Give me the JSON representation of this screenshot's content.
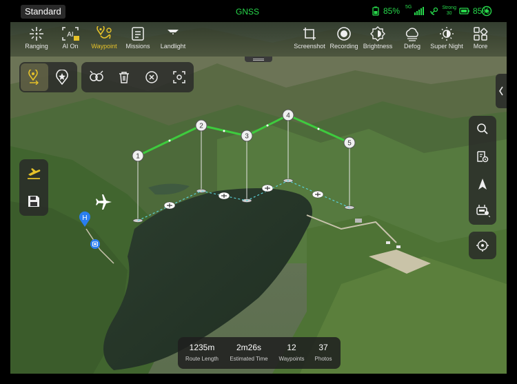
{
  "status": {
    "mode": "Standard",
    "gnss": "GNSS",
    "battery_1": "85%",
    "signal_label": "5G",
    "link_strength": "Strong",
    "link_value": "30",
    "battery_2": "85%"
  },
  "toolbar": {
    "left": [
      {
        "label": "Ranging",
        "icon": "crosshair-icon"
      },
      {
        "label": "AI On",
        "icon": "ai-icon"
      },
      {
        "label": "Waypoint",
        "icon": "waypoint-icon",
        "active": true
      },
      {
        "label": "Missions",
        "icon": "missions-icon"
      },
      {
        "label": "Landlight",
        "icon": "landlight-icon"
      }
    ],
    "right": [
      {
        "label": "Screenshot",
        "icon": "screenshot-icon"
      },
      {
        "label": "Recording",
        "icon": "record-icon"
      },
      {
        "label": "Brightness",
        "icon": "brightness-icon"
      },
      {
        "label": "Defog",
        "icon": "defog-icon"
      },
      {
        "label": "Super Night",
        "icon": "night-icon"
      },
      {
        "label": "More",
        "icon": "more-icon"
      }
    ]
  },
  "waypoints": {
    "labels": [
      "1",
      "2",
      "3",
      "4",
      "5"
    ],
    "home_label": "H"
  },
  "stats": {
    "route_length_value": "1235m",
    "route_length_label": "Route Length",
    "time_value": "2m26s",
    "time_label": "Estimated Time",
    "waypoints_value": "12",
    "waypoints_label": "Waypoints",
    "photos_value": "37",
    "photos_label": "Photos"
  },
  "colors": {
    "accent_yellow": "#e6c229",
    "route_green": "#3ecb3e",
    "status_green": "#27d94b",
    "home_blue": "#2a7ef0"
  }
}
